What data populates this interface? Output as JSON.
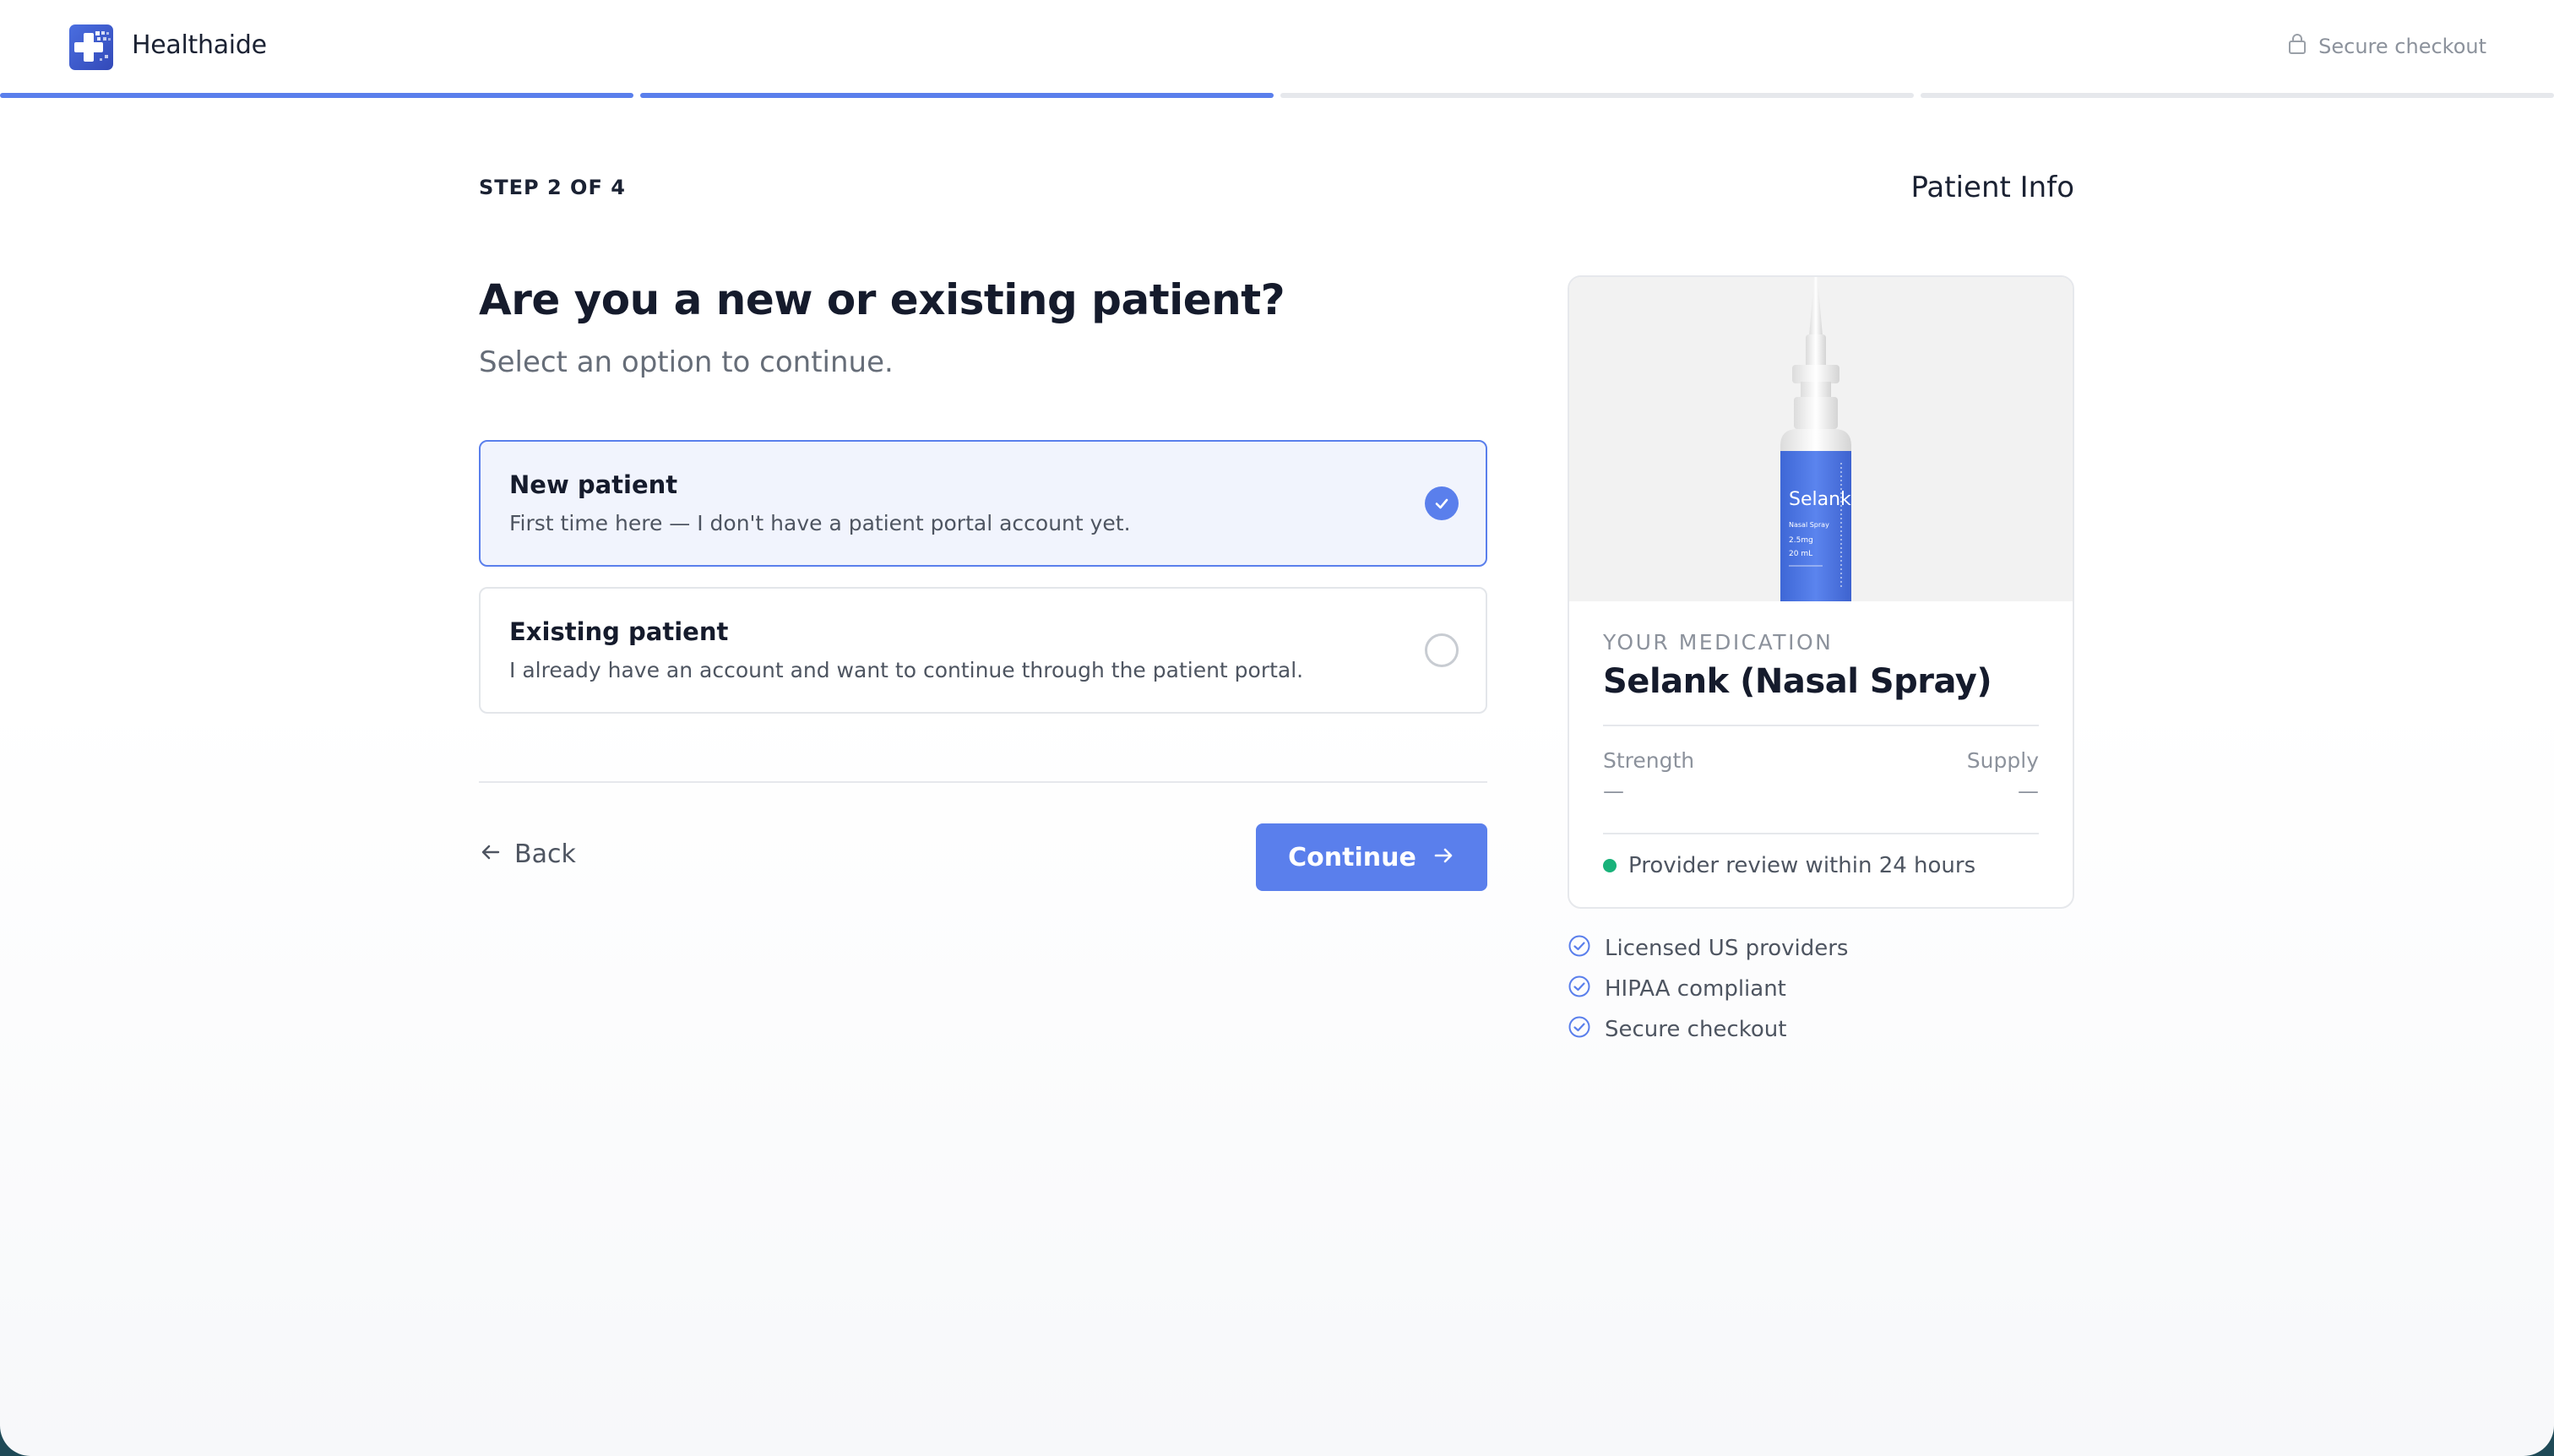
{
  "header": {
    "brand": "Healthaide",
    "secure_checkout": "Secure checkout"
  },
  "progress": {
    "current_step": 2,
    "total_steps": 4
  },
  "step": {
    "label": "STEP 2 OF 4",
    "name": "Patient Info"
  },
  "question": {
    "title": "Are you a new or existing patient?",
    "subtitle": "Select an option to continue."
  },
  "options": [
    {
      "title": "New patient",
      "description": "First time here — I don't have a patient portal account yet.",
      "selected": true
    },
    {
      "title": "Existing patient",
      "description": "I already have an account and want to continue through the patient portal.",
      "selected": false
    }
  ],
  "nav": {
    "back_label": "Back",
    "continue_label": "Continue"
  },
  "medication": {
    "caption": "YOUR MEDICATION",
    "name": "Selank (Nasal Spray)",
    "strength_label": "Strength",
    "strength_value": "—",
    "supply_label": "Supply",
    "supply_value": "—",
    "review_text": "Provider review within 24 hours",
    "bottle_label": {
      "brand": "Selank",
      "line1": "Nasal Spray",
      "line2": "2.5mg",
      "line3": "20 mL"
    }
  },
  "trust": [
    {
      "text": "Licensed US providers"
    },
    {
      "text": "HIPAA compliant"
    },
    {
      "text": "Secure checkout"
    }
  ],
  "colors": {
    "accent": "#5a7fec",
    "accent_dark": "#3349b8",
    "status_green": "#19b27a",
    "text_primary": "#151b2c",
    "text_secondary": "#4e5561",
    "text_muted": "#8c929c"
  }
}
